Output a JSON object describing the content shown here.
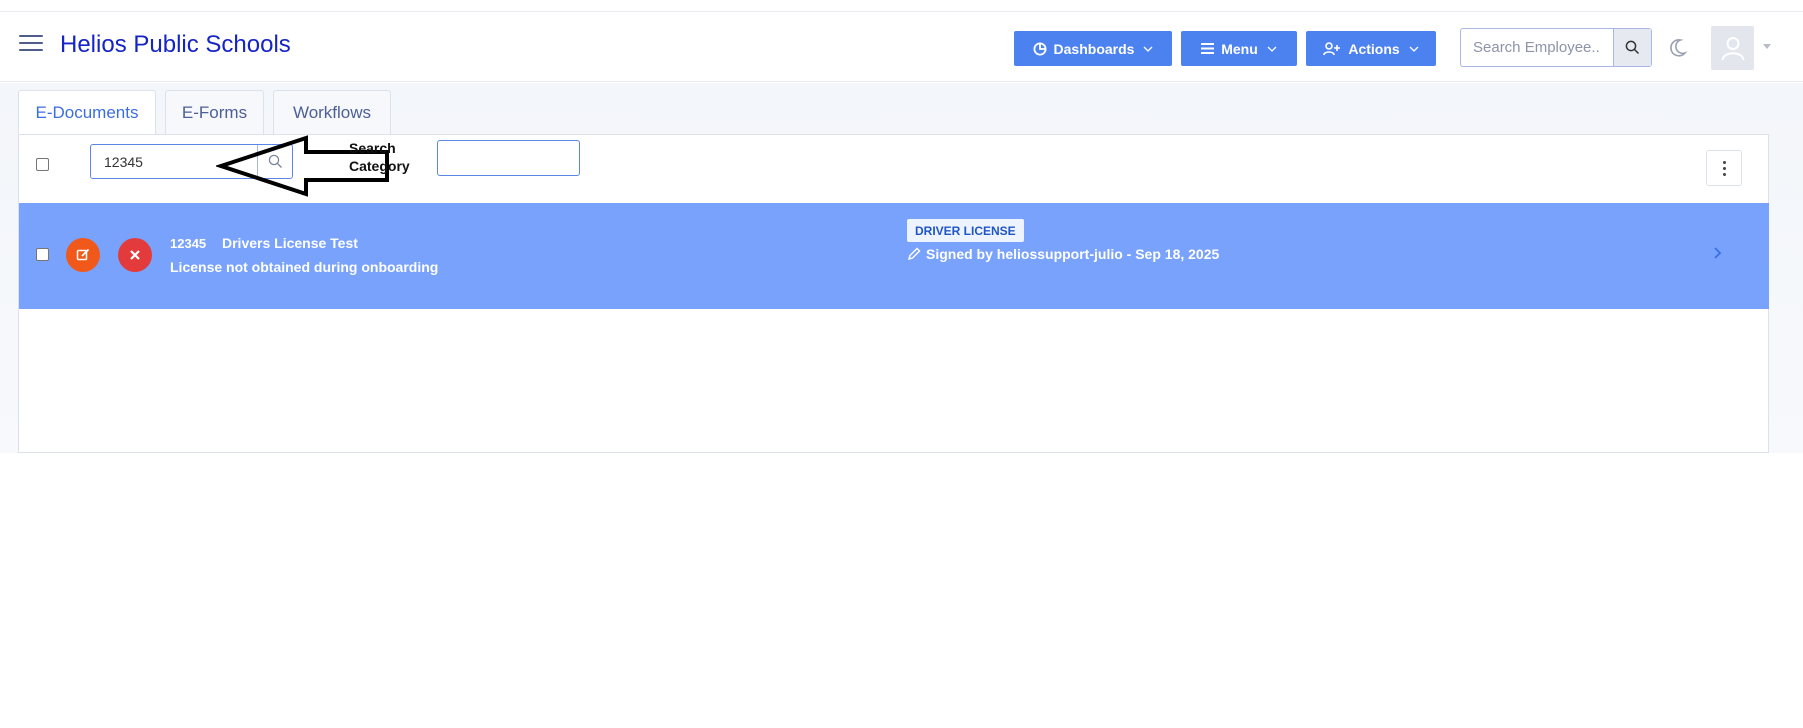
{
  "header": {
    "brand": "Helios Public Schools",
    "dashboards_label": "Dashboards",
    "menu_label": "Menu",
    "actions_label": "Actions",
    "employee_search_placeholder": "Search Employee..",
    "icons": [
      "menu-icon",
      "pie-chart-icon",
      "list-icon",
      "user-plus-icon",
      "search-icon",
      "moon-icon",
      "user-icon",
      "chevron-down-icon"
    ]
  },
  "tabs": [
    {
      "label": "E-Documents",
      "active": true
    },
    {
      "label": "E-Forms",
      "active": false
    },
    {
      "label": "Workflows",
      "active": false
    }
  ],
  "toolbar": {
    "search_value": "12345",
    "search_category_label": "Search Category",
    "search_category_value": ""
  },
  "documents": [
    {
      "id": "12345",
      "name": "Drivers License Test",
      "description": "License not obtained during onboarding",
      "category_badge": "DRIVER LICENSE",
      "signed_text": "Signed by heliossupport-julio  - Sep 18, 2025"
    }
  ],
  "colors": {
    "brand": "#1524c7",
    "primary_button": "#4c82f0",
    "row_highlight": "#79a2fd",
    "edit_button": "#f1591a",
    "delete_button": "#e33b3b"
  }
}
